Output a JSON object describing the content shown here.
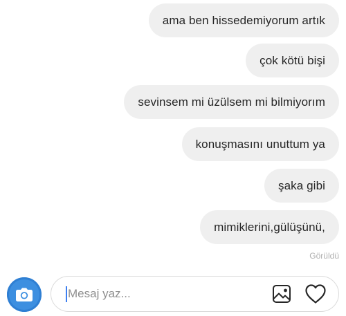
{
  "messages": [
    {
      "text": "ama ben hissedemiyorum artık"
    },
    {
      "text": "çok kötü bişi"
    },
    {
      "text": "sevinsem mi üzülsem mi bilmiyorım"
    },
    {
      "text": "konuşmasını unuttum ya"
    },
    {
      "text": "şaka gibi"
    },
    {
      "text": "mimiklerini,gülüşünü,"
    }
  ],
  "seen_label": "Görüldü",
  "composer": {
    "placeholder": "Mesaj yaz..."
  },
  "icons": {
    "camera": "camera-icon",
    "gallery": "gallery-icon",
    "like": "heart-icon"
  },
  "colors": {
    "bubble_bg": "#efefef",
    "camera_button": "#3d8fe0",
    "caret": "#3d7ff0"
  }
}
